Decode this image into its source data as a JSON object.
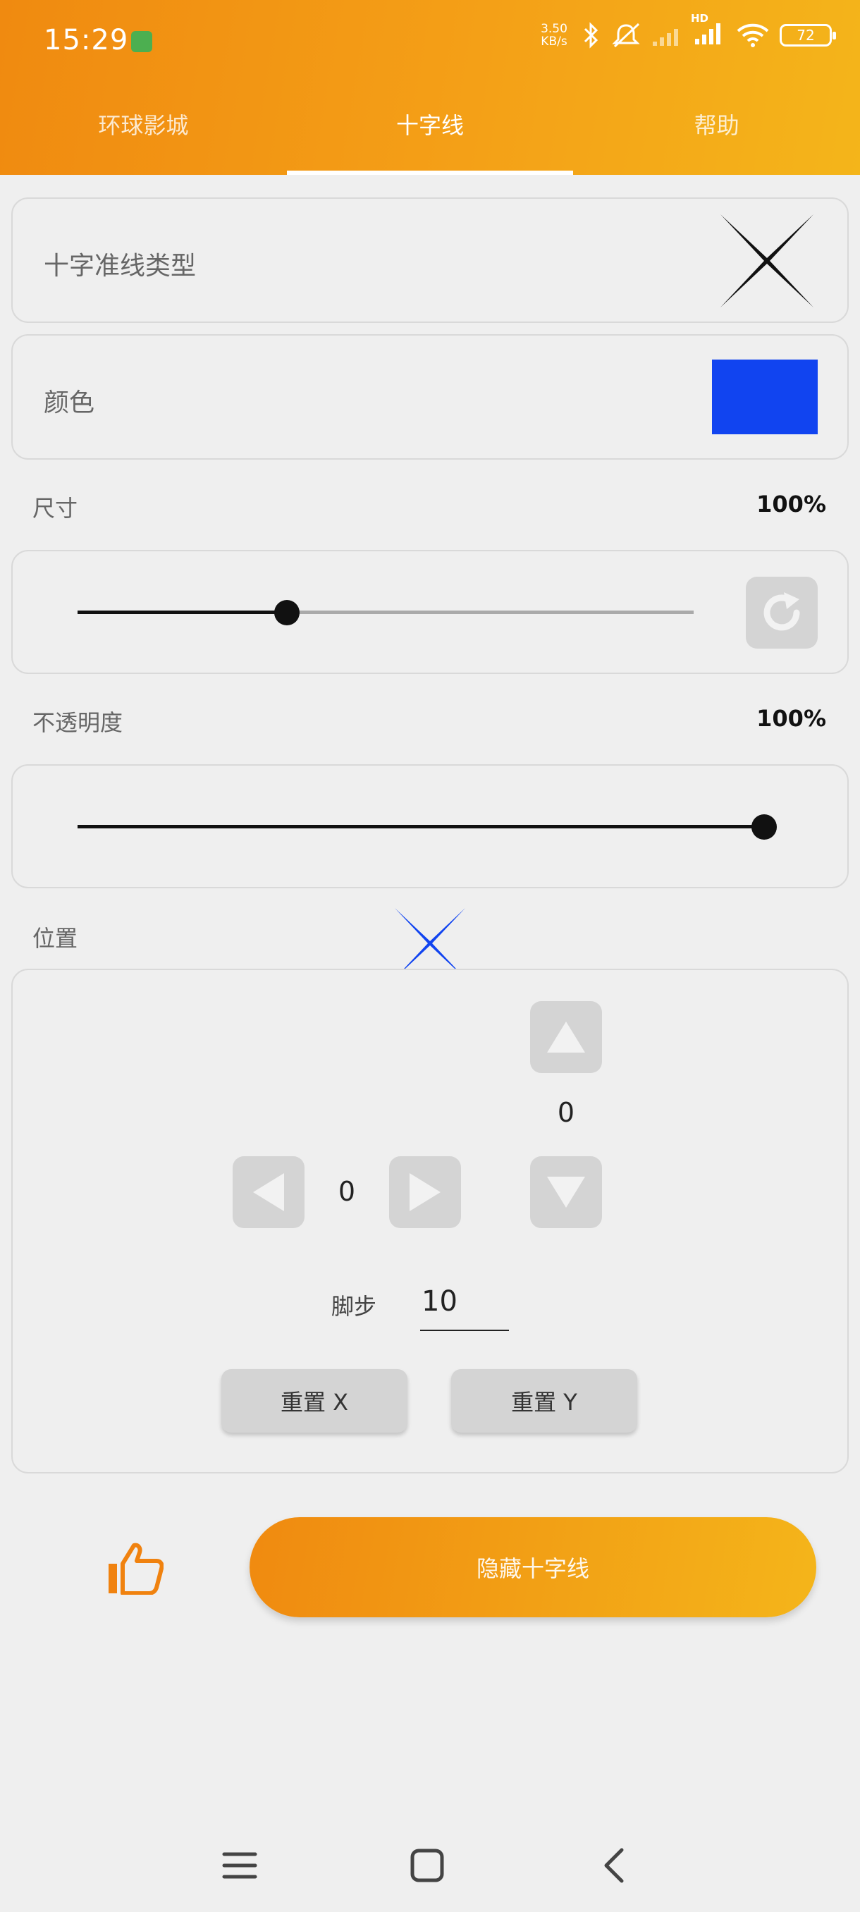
{
  "status_bar": {
    "time": "15:29",
    "net_speed_value": "3.50",
    "net_speed_unit": "KB/s",
    "hd_label": "HD",
    "battery": "72"
  },
  "tabs": [
    {
      "label": "环球影城",
      "active": false
    },
    {
      "label": "十字线",
      "active": true
    },
    {
      "label": "帮助",
      "active": false
    }
  ],
  "crosshair_type": {
    "label": "十字准线类型",
    "icon": "x-crosshair-icon"
  },
  "color": {
    "label": "颜色",
    "value": "#1144f0"
  },
  "size": {
    "label": "尺寸",
    "value": "100%",
    "slider_fraction": 0.34
  },
  "opacity": {
    "label": "不透明度",
    "value": "100%",
    "slider_fraction": 1.0
  },
  "position": {
    "label": "位置",
    "x_value": "0",
    "y_value": "0",
    "step_label": "脚步",
    "step_value": "10",
    "reset_x_label": "重置 X",
    "reset_y_label": "重置 Y"
  },
  "actions": {
    "hide_label": "隐藏十字线",
    "accent": "#f29412"
  }
}
